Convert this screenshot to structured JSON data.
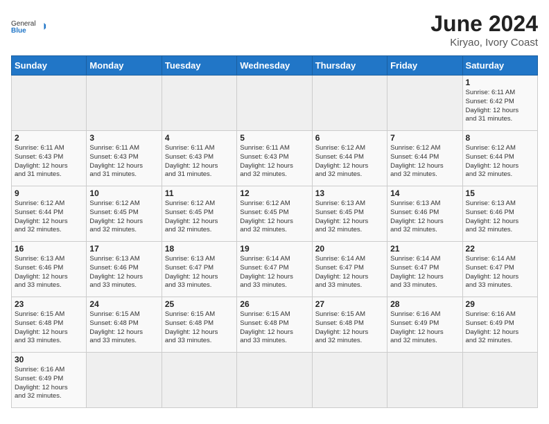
{
  "header": {
    "logo_general": "General",
    "logo_blue": "Blue",
    "month_year": "June 2024",
    "location": "Kiryao, Ivory Coast"
  },
  "weekdays": [
    "Sunday",
    "Monday",
    "Tuesday",
    "Wednesday",
    "Thursday",
    "Friday",
    "Saturday"
  ],
  "weeks": [
    [
      {
        "day": "",
        "info": ""
      },
      {
        "day": "",
        "info": ""
      },
      {
        "day": "",
        "info": ""
      },
      {
        "day": "",
        "info": ""
      },
      {
        "day": "",
        "info": ""
      },
      {
        "day": "",
        "info": ""
      },
      {
        "day": "1",
        "info": "Sunrise: 6:11 AM\nSunset: 6:42 PM\nDaylight: 12 hours\nand 31 minutes."
      }
    ],
    [
      {
        "day": "2",
        "info": "Sunrise: 6:11 AM\nSunset: 6:43 PM\nDaylight: 12 hours\nand 31 minutes."
      },
      {
        "day": "3",
        "info": "Sunrise: 6:11 AM\nSunset: 6:43 PM\nDaylight: 12 hours\nand 31 minutes."
      },
      {
        "day": "4",
        "info": "Sunrise: 6:11 AM\nSunset: 6:43 PM\nDaylight: 12 hours\nand 31 minutes."
      },
      {
        "day": "5",
        "info": "Sunrise: 6:11 AM\nSunset: 6:43 PM\nDaylight: 12 hours\nand 32 minutes."
      },
      {
        "day": "6",
        "info": "Sunrise: 6:12 AM\nSunset: 6:44 PM\nDaylight: 12 hours\nand 32 minutes."
      },
      {
        "day": "7",
        "info": "Sunrise: 6:12 AM\nSunset: 6:44 PM\nDaylight: 12 hours\nand 32 minutes."
      },
      {
        "day": "8",
        "info": "Sunrise: 6:12 AM\nSunset: 6:44 PM\nDaylight: 12 hours\nand 32 minutes."
      }
    ],
    [
      {
        "day": "9",
        "info": "Sunrise: 6:12 AM\nSunset: 6:44 PM\nDaylight: 12 hours\nand 32 minutes."
      },
      {
        "day": "10",
        "info": "Sunrise: 6:12 AM\nSunset: 6:45 PM\nDaylight: 12 hours\nand 32 minutes."
      },
      {
        "day": "11",
        "info": "Sunrise: 6:12 AM\nSunset: 6:45 PM\nDaylight: 12 hours\nand 32 minutes."
      },
      {
        "day": "12",
        "info": "Sunrise: 6:12 AM\nSunset: 6:45 PM\nDaylight: 12 hours\nand 32 minutes."
      },
      {
        "day": "13",
        "info": "Sunrise: 6:13 AM\nSunset: 6:45 PM\nDaylight: 12 hours\nand 32 minutes."
      },
      {
        "day": "14",
        "info": "Sunrise: 6:13 AM\nSunset: 6:46 PM\nDaylight: 12 hours\nand 32 minutes."
      },
      {
        "day": "15",
        "info": "Sunrise: 6:13 AM\nSunset: 6:46 PM\nDaylight: 12 hours\nand 32 minutes."
      }
    ],
    [
      {
        "day": "16",
        "info": "Sunrise: 6:13 AM\nSunset: 6:46 PM\nDaylight: 12 hours\nand 33 minutes."
      },
      {
        "day": "17",
        "info": "Sunrise: 6:13 AM\nSunset: 6:46 PM\nDaylight: 12 hours\nand 33 minutes."
      },
      {
        "day": "18",
        "info": "Sunrise: 6:13 AM\nSunset: 6:47 PM\nDaylight: 12 hours\nand 33 minutes."
      },
      {
        "day": "19",
        "info": "Sunrise: 6:14 AM\nSunset: 6:47 PM\nDaylight: 12 hours\nand 33 minutes."
      },
      {
        "day": "20",
        "info": "Sunrise: 6:14 AM\nSunset: 6:47 PM\nDaylight: 12 hours\nand 33 minutes."
      },
      {
        "day": "21",
        "info": "Sunrise: 6:14 AM\nSunset: 6:47 PM\nDaylight: 12 hours\nand 33 minutes."
      },
      {
        "day": "22",
        "info": "Sunrise: 6:14 AM\nSunset: 6:47 PM\nDaylight: 12 hours\nand 33 minutes."
      }
    ],
    [
      {
        "day": "23",
        "info": "Sunrise: 6:15 AM\nSunset: 6:48 PM\nDaylight: 12 hours\nand 33 minutes."
      },
      {
        "day": "24",
        "info": "Sunrise: 6:15 AM\nSunset: 6:48 PM\nDaylight: 12 hours\nand 33 minutes."
      },
      {
        "day": "25",
        "info": "Sunrise: 6:15 AM\nSunset: 6:48 PM\nDaylight: 12 hours\nand 33 minutes."
      },
      {
        "day": "26",
        "info": "Sunrise: 6:15 AM\nSunset: 6:48 PM\nDaylight: 12 hours\nand 33 minutes."
      },
      {
        "day": "27",
        "info": "Sunrise: 6:15 AM\nSunset: 6:48 PM\nDaylight: 12 hours\nand 32 minutes."
      },
      {
        "day": "28",
        "info": "Sunrise: 6:16 AM\nSunset: 6:49 PM\nDaylight: 12 hours\nand 32 minutes."
      },
      {
        "day": "29",
        "info": "Sunrise: 6:16 AM\nSunset: 6:49 PM\nDaylight: 12 hours\nand 32 minutes."
      }
    ],
    [
      {
        "day": "30",
        "info": "Sunrise: 6:16 AM\nSunset: 6:49 PM\nDaylight: 12 hours\nand 32 minutes."
      },
      {
        "day": "",
        "info": ""
      },
      {
        "day": "",
        "info": ""
      },
      {
        "day": "",
        "info": ""
      },
      {
        "day": "",
        "info": ""
      },
      {
        "day": "",
        "info": ""
      },
      {
        "day": "",
        "info": ""
      }
    ]
  ]
}
